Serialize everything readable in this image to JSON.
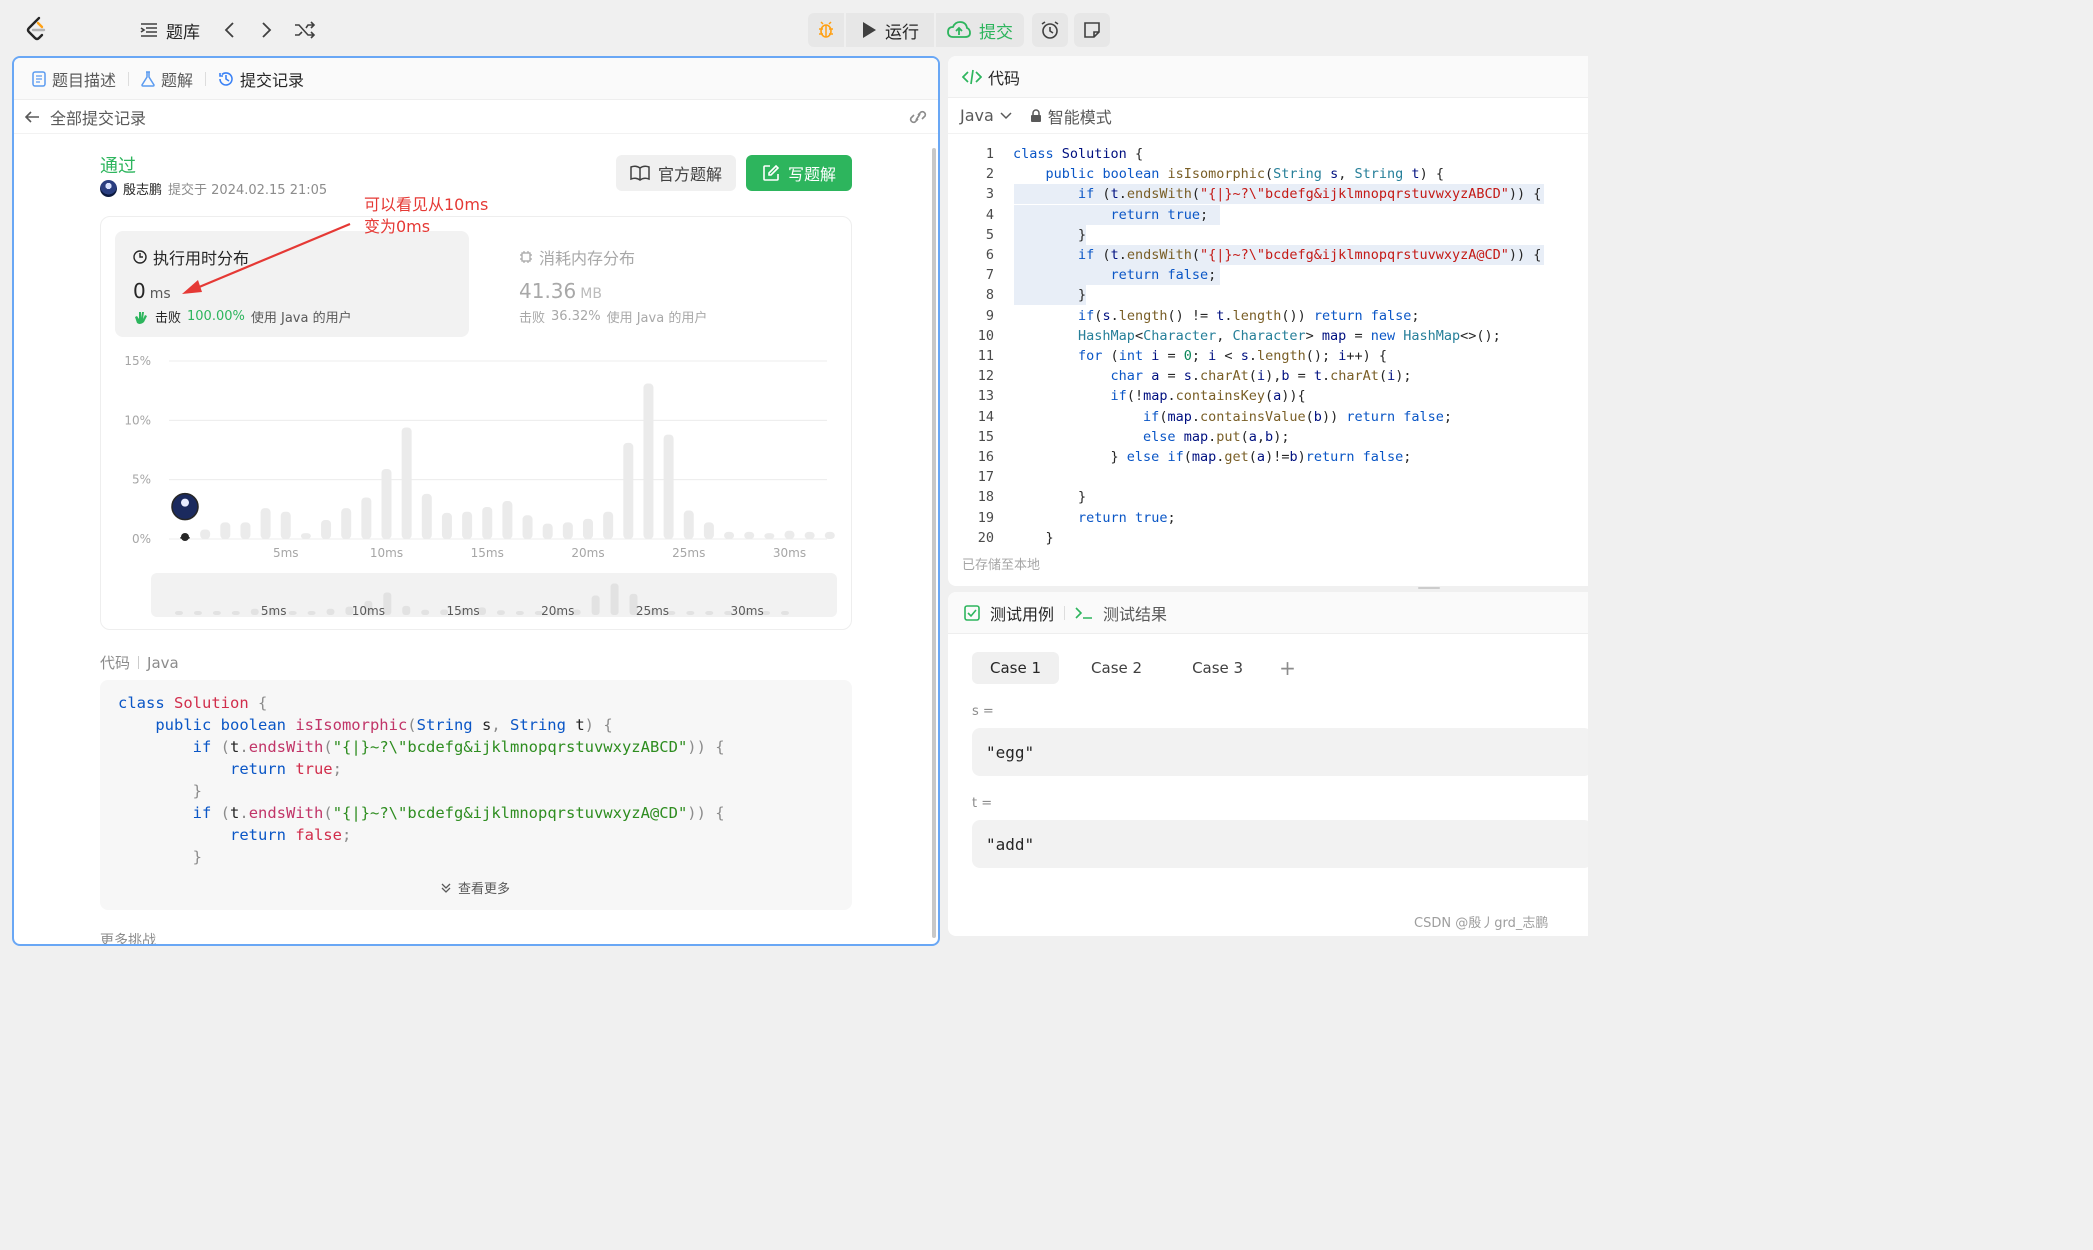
{
  "topbar": {
    "problem_bank": "题库",
    "run": "运行",
    "submit": "提交"
  },
  "left": {
    "tabs": [
      "题目描述",
      "题解",
      "提交记录"
    ],
    "back_label": "全部提交记录",
    "status": "通过",
    "user": "殷志鹏",
    "submitted_at": "提交于 2024.02.15 21:05",
    "official_solution": "官方题解",
    "write_solution": "写题解",
    "annotation_line1": "可以看见从10ms",
    "annotation_line2": "变为0ms",
    "runtime": {
      "title": "执行用时分布",
      "value": "0",
      "unit": "ms",
      "beat_label": "击败",
      "beat_pct": "100.00%",
      "beat_rest": "使用 Java 的用户"
    },
    "memory": {
      "title": "消耗内存分布",
      "value": "41.36",
      "unit": "MB",
      "beat_label": "击败",
      "beat_pct": "36.32%",
      "beat_rest": "使用 Java 的用户"
    },
    "code_label": "代码",
    "code_lang": "Java",
    "see_more": "查看更多",
    "more_text": "更多挑战"
  },
  "chart_data": {
    "type": "bar",
    "ylim": [
      0,
      15
    ],
    "y_ticks": [
      "15%",
      "10%",
      "5%",
      "0%"
    ],
    "x_tick_labels": [
      "5ms",
      "10ms",
      "15ms",
      "20ms",
      "25ms",
      "30ms"
    ],
    "x": [
      0,
      1,
      2,
      3,
      4,
      5,
      6,
      7,
      8,
      9,
      10,
      11,
      12,
      13,
      14,
      15,
      16,
      17,
      18,
      19,
      20,
      21,
      22,
      23,
      24,
      25,
      26,
      27,
      28,
      29,
      30,
      31,
      32
    ],
    "values": [
      0.2,
      0.8,
      1.4,
      1.4,
      2.6,
      2.3,
      0.5,
      1.6,
      2.6,
      3.5,
      5.9,
      9.4,
      3.8,
      2.2,
      2.3,
      2.7,
      3.2,
      2.0,
      1.3,
      1.4,
      1.7,
      2.3,
      8.1,
      13.1,
      8.8,
      2.4,
      1.4,
      0.6,
      0.6,
      0.5,
      0.7,
      0.6,
      0.6
    ],
    "highlight_index": 0,
    "grid": true
  },
  "code_lines": [
    [
      "k:class ",
      "kr:Solution ",
      "pun:{"
    ],
    [
      "vr:    ",
      "k:public ",
      "k:boolean ",
      "fn:isIsomorphic",
      "pun:(",
      "ty:String ",
      "vr:s",
      "pun:, ",
      "ty:String ",
      "vr:t",
      "pun:) {"
    ],
    [
      "vr:        ",
      "k:if ",
      "pun:(",
      "vr:t",
      "pun:.",
      "fn:endsWith",
      "pun:(",
      "str:\"{|}~?\\\"bcdefg&ijklmnopqrstuvwxyzABCD\"",
      "pun:)) {"
    ],
    [
      "vr:            ",
      "k:return ",
      "kr:true",
      "pun:;"
    ],
    [
      "vr:        ",
      "pun:}"
    ],
    [
      "vr:        ",
      "k:if ",
      "pun:(",
      "vr:t",
      "pun:.",
      "fn:endsWith",
      "pun:(",
      "str:\"{|}~?\\\"bcdefg&ijklmnopqrstuvwxyzA@CD\"",
      "pun:)) {"
    ],
    [
      "vr:            ",
      "k:return ",
      "kr:false",
      "pun:;"
    ],
    [
      "vr:        ",
      "pun:}"
    ]
  ],
  "right": {
    "title": "代码",
    "lang": "Java",
    "mode": "智能模式",
    "saved": "已存储至本地",
    "editor_lines": [
      "class Solution {",
      "    public boolean isIsomorphic(String s, String t) {",
      "        if (t.endsWith(\"{|}~?\\\"bcdefg&ijklmnopqrstuvwxyzABCD\")) {",
      "            return true;",
      "        }",
      "        if (t.endsWith(\"{|}~?\\\"bcdefg&ijklmnopqrstuvwxyzA@CD\")) {",
      "            return false;",
      "        }",
      "        if(s.length() != t.length()) return false;",
      "        HashMap<Character, Character> map = new HashMap<>();",
      "        for (int i = 0; i < s.length(); i++) {",
      "            char a = s.charAt(i),b = t.charAt(i);",
      "            if(!map.containsKey(a)){",
      "                if(map.containsValue(b)) return false;",
      "                else map.put(a,b);",
      "            } else if(map.get(a)!=b)return false;",
      "",
      "        }",
      "        return true;",
      "    }"
    ],
    "test_tab": "测试用例",
    "result_tab": "测试结果",
    "cases": [
      "Case 1",
      "Case 2",
      "Case 3"
    ],
    "var_s_label": "s =",
    "var_s_value": "\"egg\"",
    "var_t_label": "t =",
    "var_t_value": "\"add\""
  },
  "watermark": "CSDN @殷丿grd_志鹏",
  "colors": {
    "accent_green": "#2db55d",
    "annotation_red": "#e53935",
    "keyword_blue": "#0a56c6",
    "panel_border": "#69a7f5"
  }
}
